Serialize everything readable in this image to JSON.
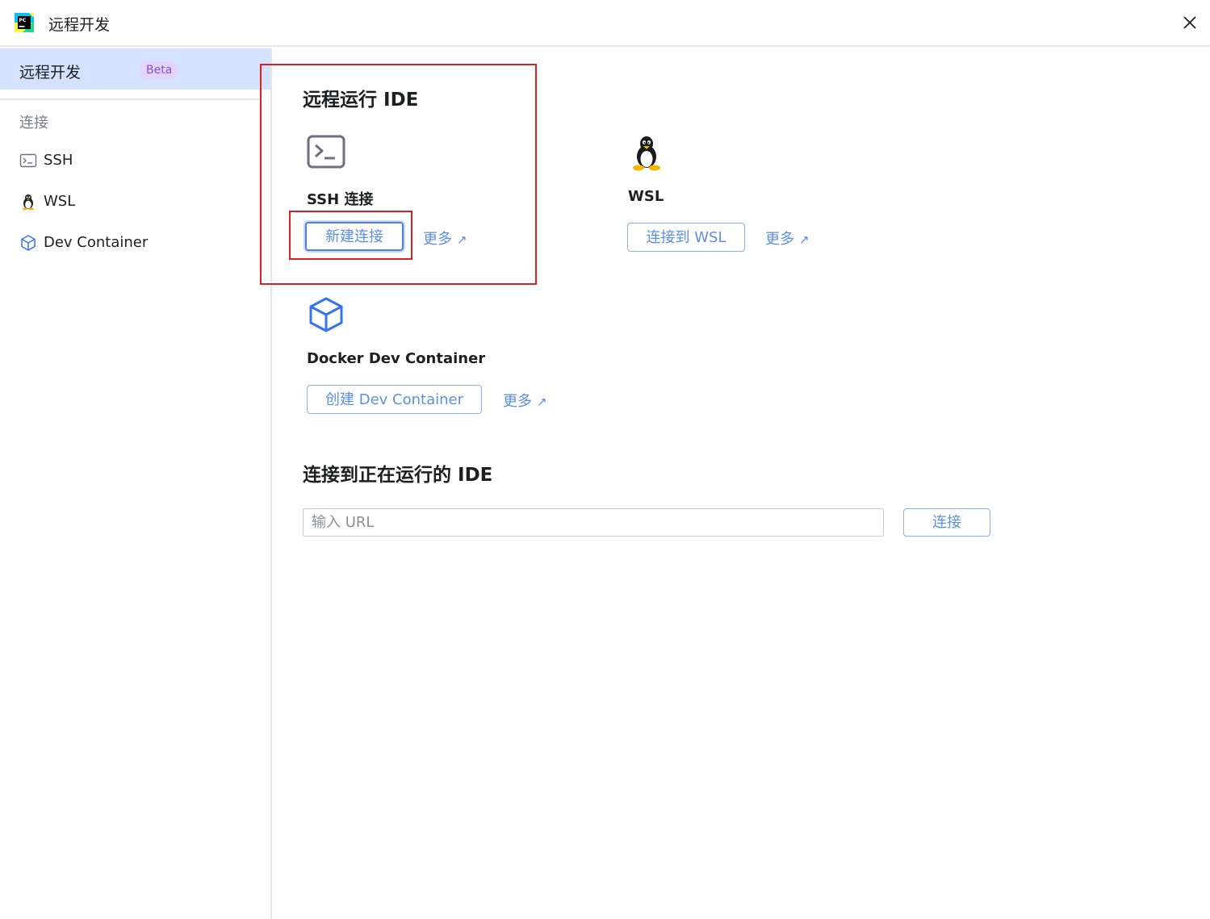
{
  "window": {
    "title": "远程开发"
  },
  "sidebar": {
    "selected": {
      "label": "远程开发",
      "badge": "Beta"
    },
    "group_label": "连接",
    "items": [
      {
        "label": "SSH",
        "icon": "terminal-icon"
      },
      {
        "label": "WSL",
        "icon": "linux-penguin-icon"
      },
      {
        "label": "Dev Container",
        "icon": "cube-icon"
      }
    ]
  },
  "main": {
    "remote_ide": {
      "title": "远程运行 IDE",
      "ssh": {
        "title": "SSH 连接",
        "button": "新建连接",
        "more": "更多",
        "icon": "terminal-icon"
      },
      "wsl": {
        "title": "WSL",
        "button": "连接到 WSL",
        "more": "更多",
        "icon": "linux-penguin-icon"
      },
      "docker": {
        "title": "Docker Dev Container",
        "button": "创建 Dev Container",
        "more": "更多",
        "icon": "cube-icon"
      }
    },
    "connect_running": {
      "title": "连接到正在运行的 IDE",
      "url_placeholder": "输入 URL",
      "url_value": "",
      "connect_button": "连接"
    }
  },
  "colors": {
    "accent": "#5b8ee8",
    "selection": "#d4e2ff",
    "beta_badge_bg": "#e3d4fb",
    "beta_badge_text": "#8a4fd7",
    "highlight": "#e02020"
  }
}
